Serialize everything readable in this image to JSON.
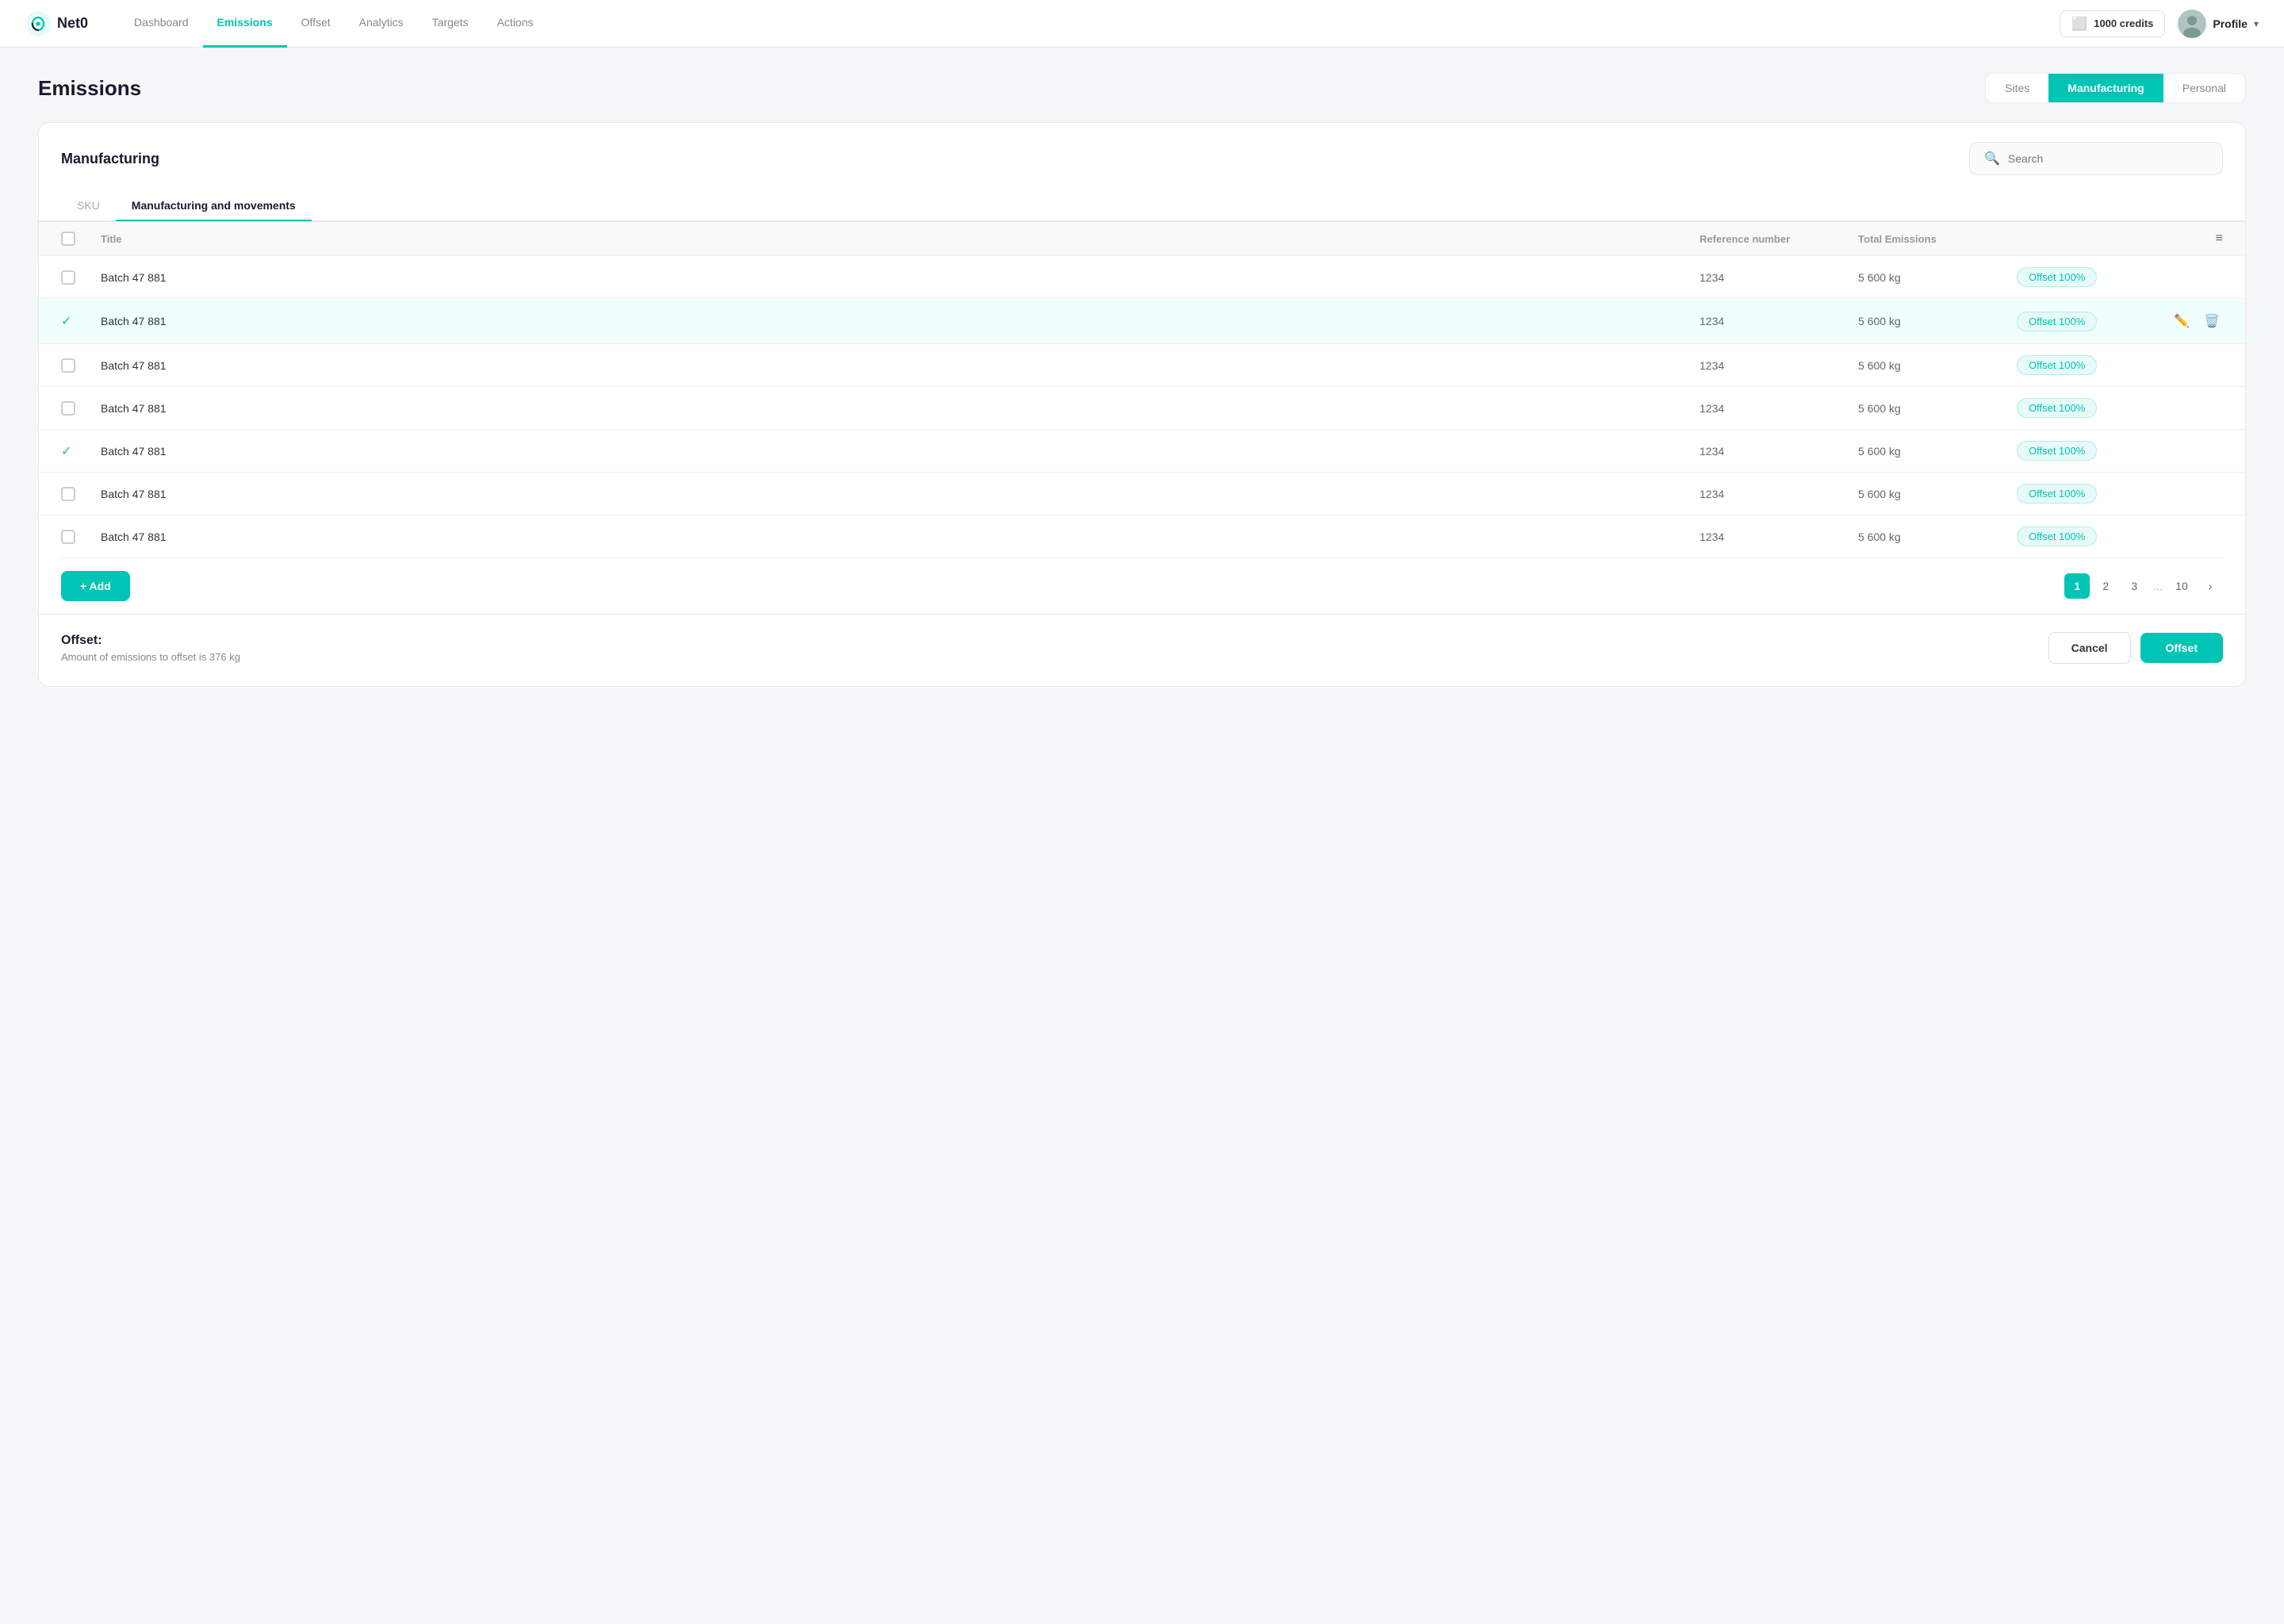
{
  "nav": {
    "logo_text": "Net0",
    "links": [
      {
        "label": "Dashboard",
        "active": false
      },
      {
        "label": "Emissions",
        "active": true
      },
      {
        "label": "Offset",
        "active": false
      },
      {
        "label": "Analytics",
        "active": false
      },
      {
        "label": "Targets",
        "active": false
      },
      {
        "label": "Actions",
        "active": false
      }
    ],
    "credits_label": "1000 credits",
    "profile_label": "Profile"
  },
  "page": {
    "title": "Emissions",
    "view_tabs": [
      {
        "label": "Sites",
        "active": false
      },
      {
        "label": "Manufacturing",
        "active": true
      },
      {
        "label": "Personal",
        "active": false
      }
    ]
  },
  "card": {
    "title": "Manufacturing",
    "search_placeholder": "Search",
    "sub_tabs": [
      {
        "label": "SKU",
        "active": false
      },
      {
        "label": "Manufacturing and movements",
        "active": true
      }
    ],
    "table": {
      "columns": [
        "",
        "Title",
        "Reference number",
        "Total Emissions",
        "",
        ""
      ],
      "rows": [
        {
          "checked": false,
          "title": "Batch 47 881",
          "ref": "1234",
          "emissions": "5 600 kg",
          "offset_label": "Offset 100%",
          "show_actions": false
        },
        {
          "checked": true,
          "title": "Batch 47 881",
          "ref": "1234",
          "emissions": "5 600 kg",
          "offset_label": "Offset 100%",
          "show_actions": true
        },
        {
          "checked": false,
          "title": "Batch 47 881",
          "ref": "1234",
          "emissions": "5 600 kg",
          "offset_label": "Offset 100%",
          "show_actions": false
        },
        {
          "checked": false,
          "title": "Batch 47 881",
          "ref": "1234",
          "emissions": "5 600 kg",
          "offset_label": "Offset 100%",
          "show_actions": false
        },
        {
          "checked": true,
          "title": "Batch 47 881",
          "ref": "1234",
          "emissions": "5 600 kg",
          "offset_label": "Offset 100%",
          "show_actions": false
        },
        {
          "checked": false,
          "title": "Batch 47 881",
          "ref": "1234",
          "emissions": "5 600 kg",
          "offset_label": "Offset 100%",
          "show_actions": false
        },
        {
          "checked": false,
          "title": "Batch 47 881",
          "ref": "1234",
          "emissions": "5 600 kg",
          "offset_label": "Offset 100%",
          "show_actions": false
        }
      ]
    },
    "add_btn_label": "+ Add",
    "pagination": {
      "pages": [
        "1",
        "2",
        "3"
      ],
      "dots": "...",
      "last": "10",
      "next": "›",
      "active": "1"
    },
    "offset_section": {
      "label": "Offset:",
      "description": "Amount of emissions to offset is 376 kg",
      "cancel_label": "Cancel",
      "offset_label": "Offset"
    }
  },
  "colors": {
    "teal": "#00c4b4",
    "teal_light": "#e6faf8",
    "teal_border": "#b2ede8"
  }
}
